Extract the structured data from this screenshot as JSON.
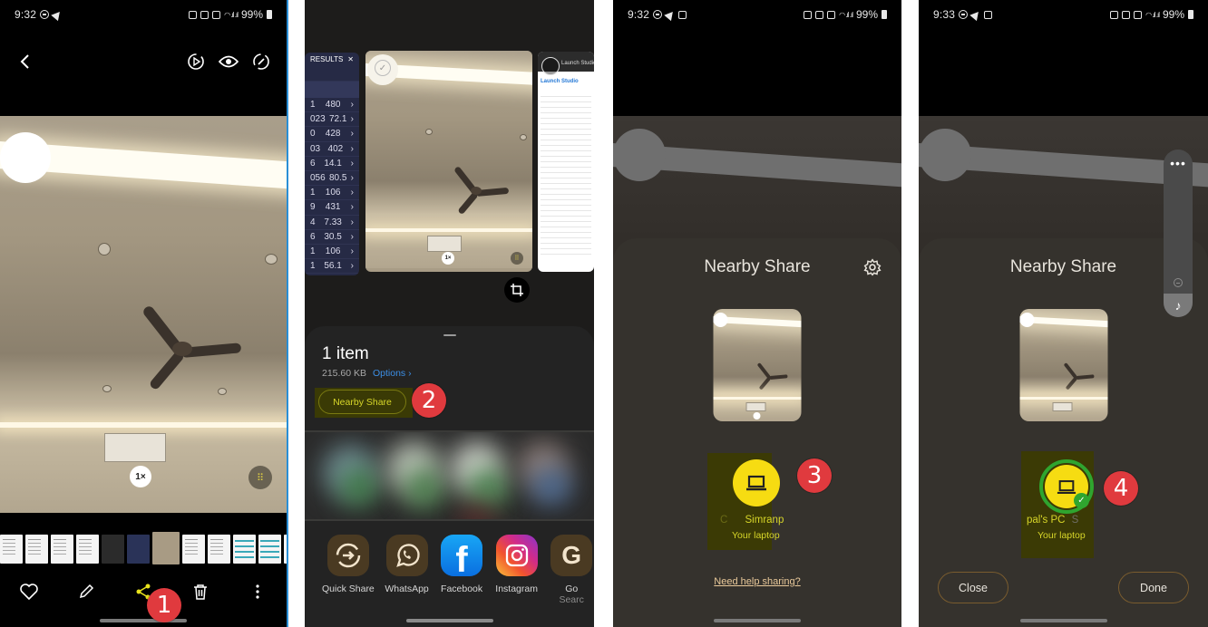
{
  "panels": [
    {
      "id": "gallery",
      "status": {
        "time": "9:32",
        "battery": "99%"
      },
      "toolbar": {
        "back": "back-icon",
        "actions": [
          "remaster-icon",
          "view-icon",
          "rotate-icon"
        ]
      },
      "photo": {
        "zoom_label": "1×"
      },
      "bottom_actions": [
        {
          "name": "favorite",
          "icon": "heart-icon"
        },
        {
          "name": "edit",
          "icon": "pencil-icon"
        },
        {
          "name": "share",
          "icon": "share-icon"
        },
        {
          "name": "delete",
          "icon": "trash-icon"
        },
        {
          "name": "more",
          "icon": "more-vert-icon"
        }
      ],
      "step_badge": "1"
    },
    {
      "id": "share-sheet",
      "speed_results": {
        "title": "RESULTS",
        "col_left": [
          "1",
          "023",
          "0",
          "03",
          "6",
          "056",
          "1",
          "9",
          "4",
          "6",
          "1",
          "1"
        ],
        "col_right": [
          "480",
          "72.1",
          "428",
          "402",
          "14.1",
          "80.5",
          "106",
          "431",
          "7.33",
          "30.5",
          "106",
          "56.1"
        ]
      },
      "preview": {
        "zoom_label": "1×"
      },
      "doc_card": {
        "title": "Launch Studio"
      },
      "sheet": {
        "title": "1 item",
        "size": "215.60 KB",
        "options_label": "Options",
        "nearby_share_label": "Nearby Share"
      },
      "apps": [
        {
          "label": "Quick Share",
          "sub": ""
        },
        {
          "label": "WhatsApp",
          "sub": ""
        },
        {
          "label": "Facebook",
          "sub": ""
        },
        {
          "label": "Instagram",
          "sub": ""
        },
        {
          "label": "Go",
          "sub": "Searc"
        }
      ],
      "step_badge": "2"
    },
    {
      "id": "nearby-share-scanning",
      "status": {
        "time": "9:32",
        "battery": "99%"
      },
      "title": "Nearby Share",
      "device": {
        "name_prefix": "C",
        "name": "Simranp",
        "type": "Your laptop"
      },
      "help_link": "Need help sharing?",
      "step_badge": "3"
    },
    {
      "id": "nearby-share-sent",
      "status": {
        "time": "9:33",
        "battery": "99%"
      },
      "title": "Nearby Share",
      "device": {
        "name": "pal's PC",
        "name_suffix": "S",
        "type": "Your laptop"
      },
      "buttons": {
        "close": "Close",
        "done": "Done"
      },
      "step_badge": "4"
    }
  ],
  "colors": {
    "badge": "#e03a3e",
    "highlight": "#d7d629",
    "nearby_icon": "#f6dc12",
    "success": "#2fa52f",
    "options_link": "#3c8fe6"
  }
}
